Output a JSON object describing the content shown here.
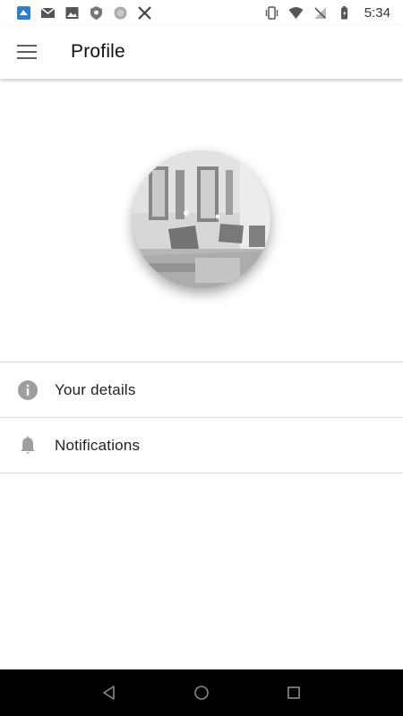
{
  "status_bar": {
    "time": "5:34",
    "left_icons": [
      "app-ei-icon",
      "gmail-icon",
      "image-icon",
      "shield-icon",
      "circle-icon",
      "tools-icon"
    ],
    "right_icons": [
      "vibrate-icon",
      "wifi-icon",
      "no-signal-icon",
      "battery-charging-icon"
    ]
  },
  "app_bar": {
    "title": "Profile",
    "menu_icon": "hamburger-menu-icon"
  },
  "profile": {
    "avatar": "profile-photo"
  },
  "menu": {
    "items": [
      {
        "label": "Your details",
        "icon": "info-icon"
      },
      {
        "label": "Notifications",
        "icon": "bell-icon"
      }
    ]
  },
  "nav_bar": {
    "buttons": [
      "back-icon",
      "home-icon",
      "recents-icon"
    ]
  },
  "colors": {
    "background": "#ffffff",
    "icon_gray": "#9e9e9e",
    "divider": "#d9d9d9",
    "nav_bar": "#000000"
  }
}
